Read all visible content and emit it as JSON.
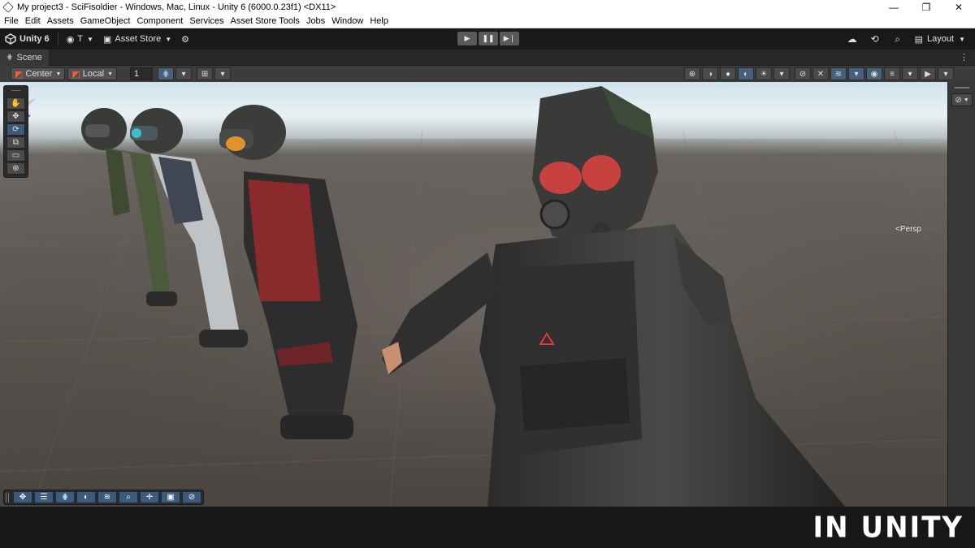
{
  "window": {
    "title": "My project3 - SciFisoldier - Windows, Mac, Linux - Unity 6 (6000.0.23f1) <DX11>",
    "controls": [
      "—",
      "❐",
      "✕"
    ]
  },
  "menu": [
    "File",
    "Edit",
    "Assets",
    "GameObject",
    "Component",
    "Services",
    "Asset Store Tools",
    "Jobs",
    "Window",
    "Help"
  ],
  "toolbar": {
    "unity_label": "Unity 6",
    "account_label": "T",
    "asset_store_label": "Asset Store",
    "layout_label": "Layout",
    "play_icons": [
      "▶",
      "❚❚",
      "▶❘"
    ]
  },
  "scene_tab": {
    "label": "Scene",
    "more": "⋮"
  },
  "scene_toolbar": {
    "pivot_label": "Center",
    "space_label": "Local",
    "grid_snap_value": "1"
  },
  "viewport": {
    "persp_label": "<Persp"
  },
  "tools": [
    "hand-tool",
    "move-tool",
    "rotate-tool",
    "scale-tool",
    "rect-tool",
    "transform-tool"
  ],
  "overlay_tools": [
    "move",
    "align",
    "grid",
    "orbit",
    "layers",
    "zoom",
    "pivot",
    "camera",
    "navigate"
  ],
  "watermark": "IN UNITY"
}
